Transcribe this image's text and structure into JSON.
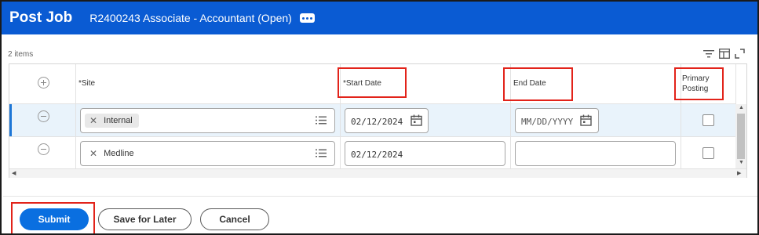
{
  "header": {
    "title": "Post Job",
    "subtitle": "R2400243 Associate - Accountant (Open)",
    "more_icon": "more-dots-icon"
  },
  "grid": {
    "item_count": "2 items",
    "toolbar_icons": [
      "filter-icon",
      "columns-icon",
      "expand-icon"
    ],
    "columns": {
      "site": "*Site",
      "start_date": "*Start Date",
      "end_date": "End Date",
      "primary_posting": [
        "Primary",
        "Posting"
      ]
    },
    "rows": [
      {
        "site": "Internal",
        "start_date": "02/12/2024",
        "end_date_placeholder": "MM/DD/YYYY",
        "primary_posting": false
      },
      {
        "site": "Medline",
        "start_date": "02/12/2024",
        "end_date": "",
        "primary_posting": false
      }
    ]
  },
  "footer": {
    "submit": "Submit",
    "save_later": "Save for Later",
    "cancel": "Cancel"
  },
  "colors": {
    "header_bg": "#0a5bd3",
    "primary_button": "#0a6fe0",
    "selected_row": "#e9f3fb",
    "highlight_box": "#e2231a"
  }
}
